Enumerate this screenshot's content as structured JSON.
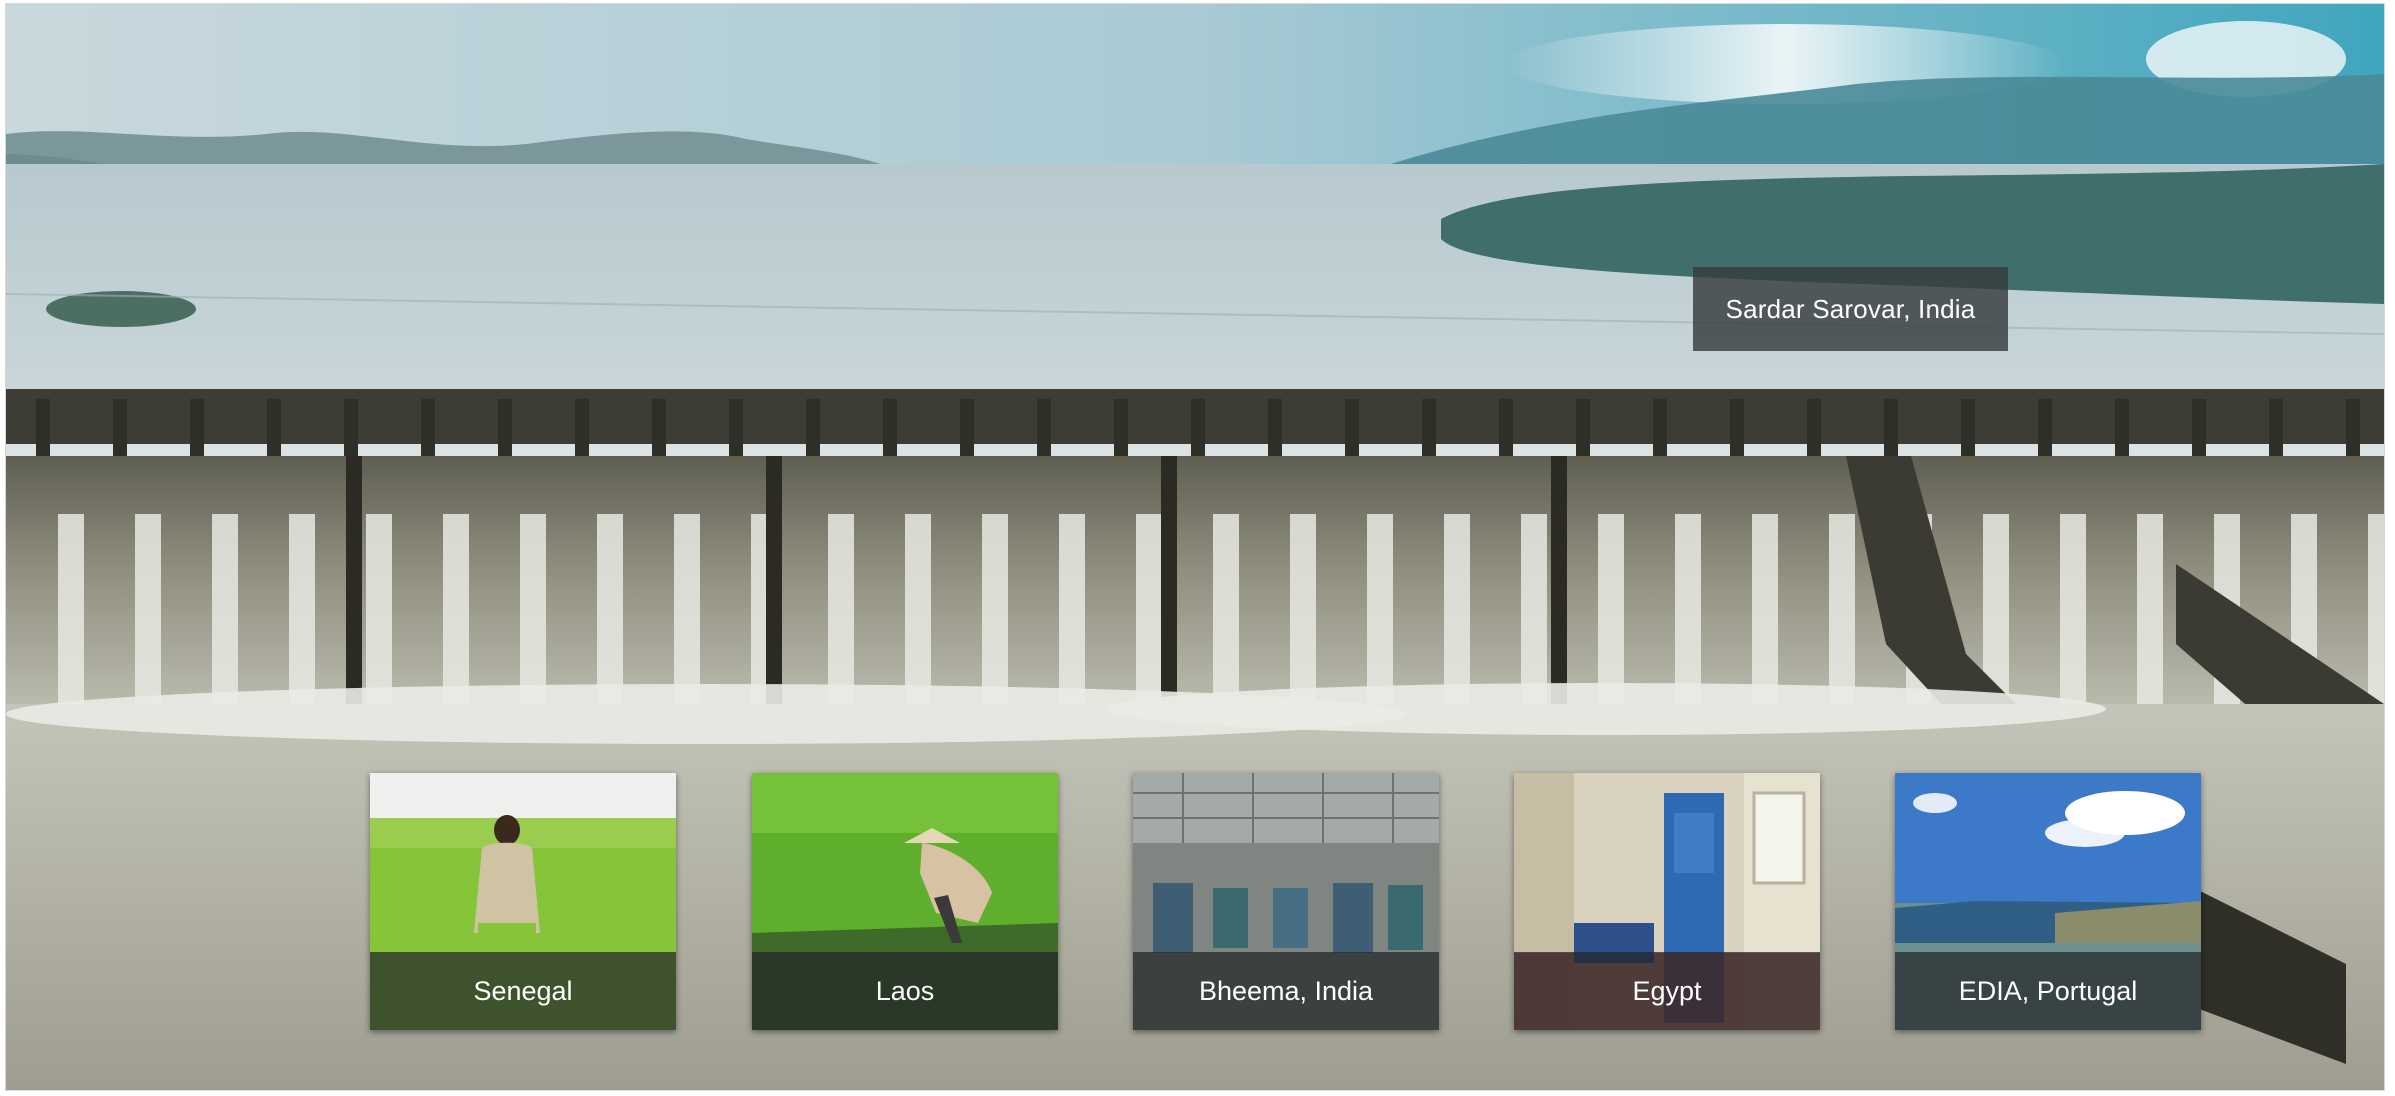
{
  "hero": {
    "caption": "Sardar Sarovar, India",
    "image": "dam-spillway-photo"
  },
  "tiles": [
    {
      "label": "Senegal",
      "image": "farmer-in-field-photo"
    },
    {
      "label": "Laos",
      "image": "rice-planting-photo"
    },
    {
      "label": "Bheema, India",
      "image": "pump-station-interior-photo"
    },
    {
      "label": "Egypt",
      "image": "pump-hall-photo"
    },
    {
      "label": "EDIA, Portugal",
      "image": "reservoir-landscape-photo"
    }
  ]
}
